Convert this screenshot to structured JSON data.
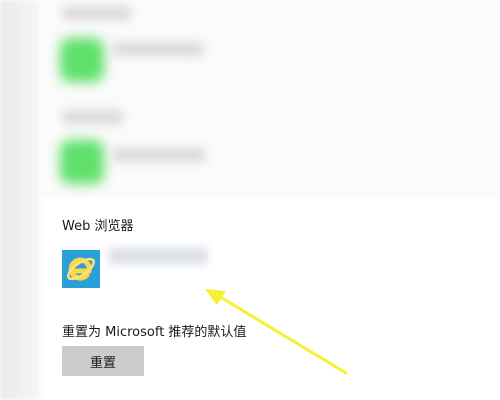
{
  "section": {
    "title": "Web 浏览器"
  },
  "web_browser": {
    "icon": "internet-explorer-icon",
    "name": ""
  },
  "reset": {
    "caption": "重置为 Microsoft 推荐的默认值",
    "button_label": "重置"
  },
  "colors": {
    "arrow": "#f5f032",
    "button_bg": "#cccccc",
    "blurred_icon": "#5ee06a"
  }
}
